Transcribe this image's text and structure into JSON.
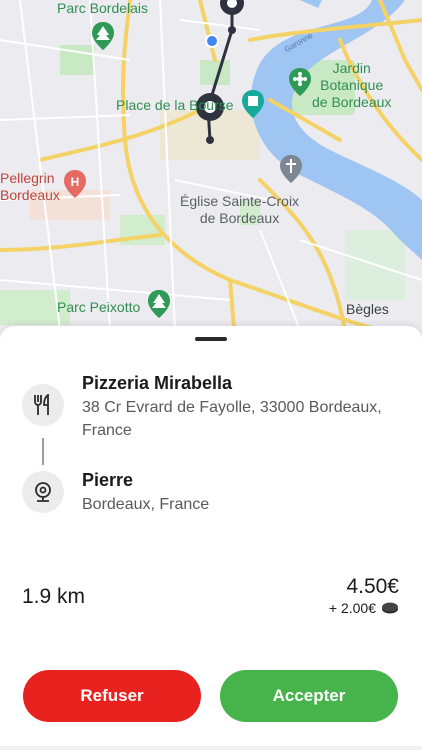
{
  "map": {
    "labels": {
      "parc_bordelais": "Parc Bordelais",
      "place_de_la_bourse": "Place de la Bourse",
      "jardin_botanique": "Jardin\nBotanique\nde Bordeaux",
      "pellegrin": "Pellegrin\nBordeaux",
      "eglise": "Église Sainte-Croix\nde Bordeaux",
      "parc_peixotto": "Parc Peixotto",
      "begles": "Bègles",
      "garonne": "Garonne"
    },
    "colors": {
      "water": "#9fc5f2",
      "road": "#f5d266",
      "park": "#c9e8c4",
      "route": "#2f3340"
    }
  },
  "delivery": {
    "pickup": {
      "icon": "fork-knife-icon",
      "name": "Pizzeria Mirabella",
      "address": "38 Cr Evrard de Fayolle, 33000 Bordeaux, France"
    },
    "dropoff": {
      "icon": "location-pin-icon",
      "name": "Pierre",
      "address": "Bordeaux, France"
    },
    "distance": "1.9 km",
    "price": "4.50€",
    "bonus": "+ 2.00€"
  },
  "actions": {
    "reject_label": "Refuser",
    "accept_label": "Accepter"
  },
  "colors": {
    "reject": "#e8221f",
    "accept": "#47b34b"
  }
}
